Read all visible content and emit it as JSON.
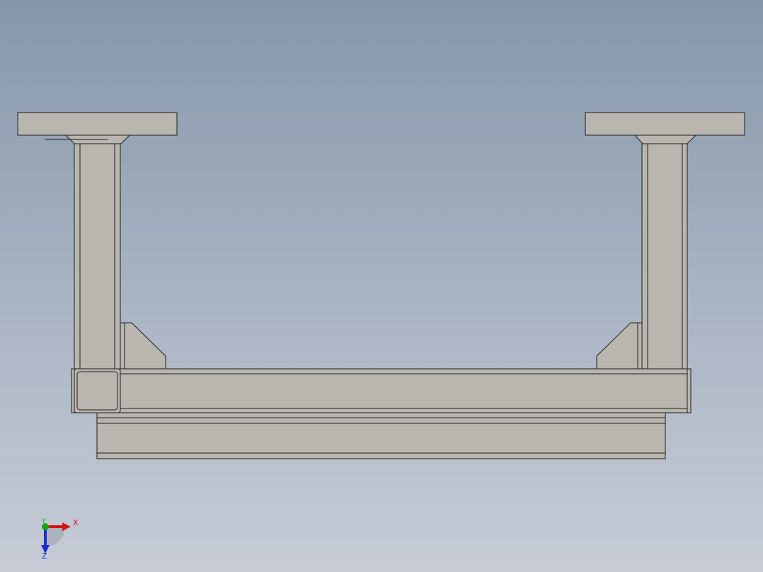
{
  "viewport": {
    "background_top": "#8796ab",
    "background_bottom": "#c7ccd6",
    "part_face_color": "#b9b6b0",
    "part_edge_color": "#1e1e1e"
  },
  "model": {
    "parts": [
      "left-top-plate",
      "right-top-plate",
      "left-vertical-post",
      "right-vertical-post",
      "left-gusset",
      "right-gusset",
      "horizontal-beam",
      "base-rail"
    ]
  },
  "triad": {
    "x_label": "X",
    "y_label": "Y",
    "z_label": "Z",
    "x_color": "#d01515",
    "y_color": "#19a319",
    "z_color": "#1a2fd0"
  }
}
